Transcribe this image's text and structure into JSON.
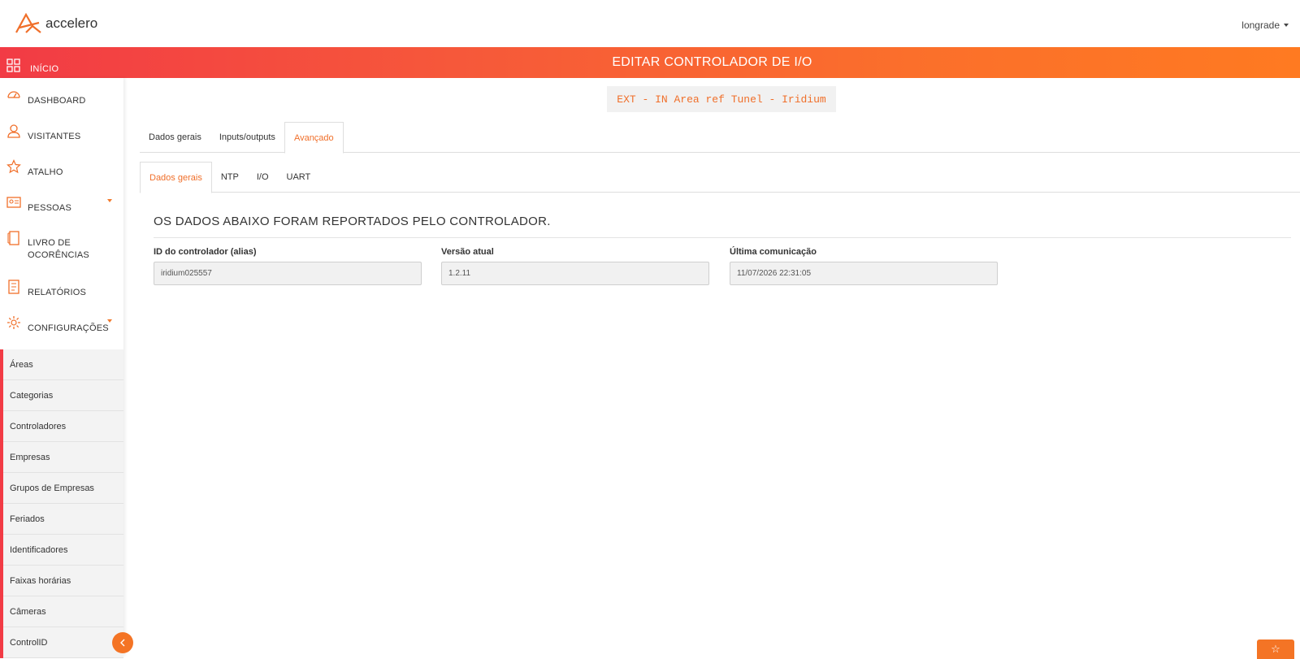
{
  "header": {
    "brand": "accelero",
    "user": "longrade"
  },
  "band": {
    "home_label": "INÍCIO",
    "title": "EDITAR CONTROLADOR DE I/O"
  },
  "sidebar": {
    "items": [
      {
        "label": "DASHBOARD",
        "icon": "dashboard-icon"
      },
      {
        "label": "VISITANTES",
        "icon": "visitor-icon"
      },
      {
        "label": "ATALHO",
        "icon": "star-icon"
      },
      {
        "label": "PESSOAS",
        "icon": "id-card-icon"
      },
      {
        "label": "LIVRO DE OCORÊNCIAS",
        "icon": "book-icon"
      },
      {
        "label": "RELATÓRIOS",
        "icon": "report-icon"
      },
      {
        "label": "CONFIGURAÇÕES",
        "icon": "gear-icon"
      }
    ],
    "sub_items": [
      "Áreas",
      "Categorias",
      "Controladores",
      "Empresas",
      "Grupos de Empresas",
      "Feriados",
      "Identificadores",
      "Faixas horárias",
      "Câmeras",
      "ControlID"
    ]
  },
  "controller_name": "EXT - IN Area ref Tunel - Iridium",
  "tabs_main": [
    "Dados gerais",
    "Inputs/outputs",
    "Avançado"
  ],
  "tabs_main_active": "Avançado",
  "tabs_sub": [
    "Dados gerais",
    "NTP",
    "I/O",
    "UART"
  ],
  "tabs_sub_active": "Dados gerais",
  "section_title": "OS DADOS ABAIXO FORAM REPORTADOS PELO CONTROLADOR.",
  "fields": [
    {
      "label": "ID do controlador (alias)",
      "value": "iridium025557"
    },
    {
      "label": "Versão atual",
      "value": "1.2.11"
    },
    {
      "label": "Última comunicação",
      "value": "11/07/2026 22:31:05"
    }
  ],
  "colors": {
    "accent": "#f06f2a",
    "band_start": "#f23b45",
    "band_end": "#ff7a21"
  }
}
